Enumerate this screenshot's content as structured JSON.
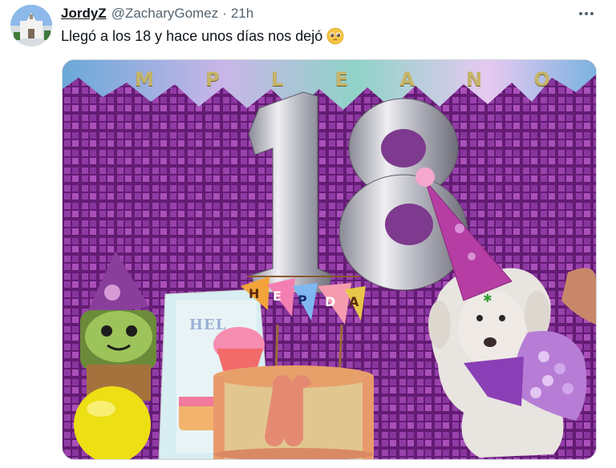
{
  "user": {
    "display_name": "JordyZ",
    "handle": "@ZacharyGomez",
    "separator": "·",
    "time": "21h"
  },
  "tweet": {
    "text": "Llegó a los 18 y hace unos días nos dejó",
    "emoji": "pleading-face-icon"
  },
  "actions": {
    "more_icon": "ellipsis-icon"
  },
  "media": {
    "banner_letters": [
      "M",
      "P",
      "L",
      "E",
      "A",
      "N",
      "O"
    ],
    "pennant_letters": [
      "H",
      "E",
      "P",
      "D",
      "A"
    ],
    "card_text": "HEL",
    "balloon_number": "18"
  },
  "colors": {
    "text_primary": "#0f1419",
    "text_secondary": "#536471",
    "media_border": "#cfd9de",
    "backdrop_purple": "#8a2f9a"
  }
}
